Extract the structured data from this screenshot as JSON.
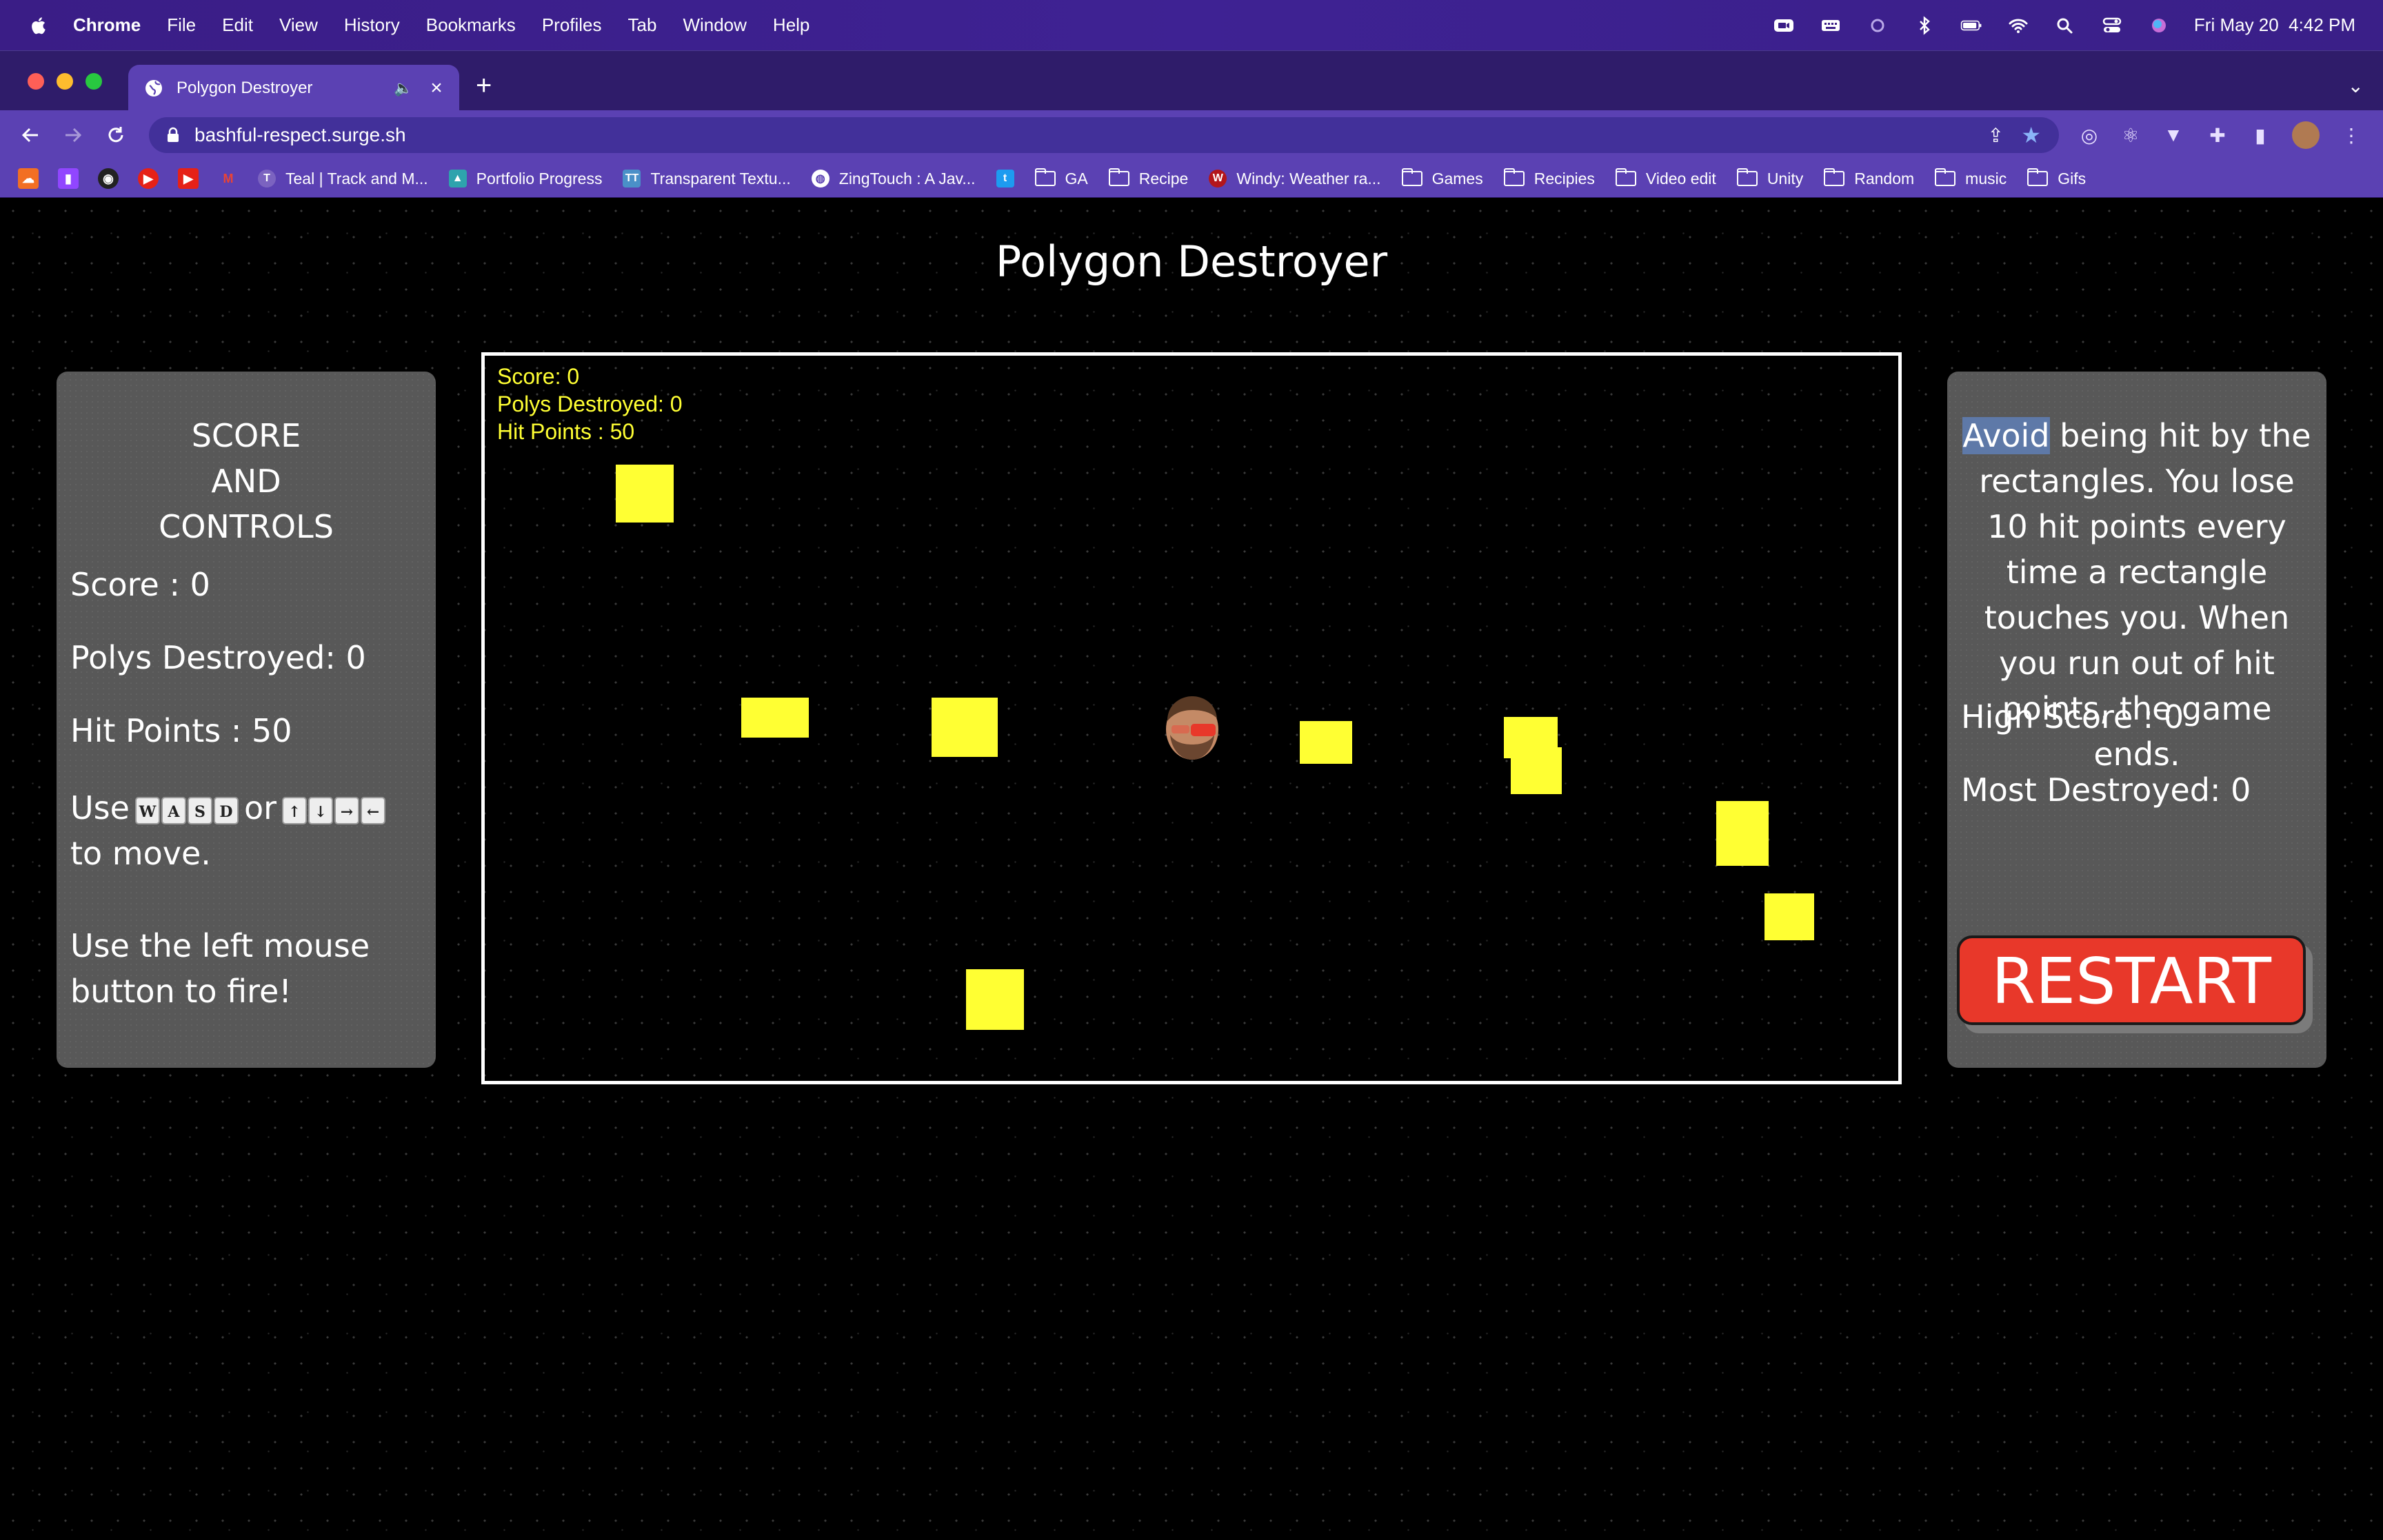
{
  "menubar": {
    "app": "Chrome",
    "items": [
      "File",
      "Edit",
      "View",
      "History",
      "Bookmarks",
      "Profiles",
      "Tab",
      "Window",
      "Help"
    ],
    "clock": "Fri May 20  4:42 PM"
  },
  "browser": {
    "tab_title": "Polygon Destroyer",
    "url": "bashful-respect.surge.sh",
    "bookmarks": [
      "Teal | Track and M...",
      "Portfolio Progress",
      "Transparent Textu...",
      "ZingTouch : A Jav...",
      "GA",
      "Recipe",
      "Windy: Weather ra...",
      "Games",
      "Recipies",
      "Video edit",
      "Unity",
      "Random",
      "music",
      "Gifs"
    ]
  },
  "page": {
    "title": "Polygon Destroyer"
  },
  "left_panel": {
    "heading_line1": "SCORE",
    "heading_line2": "AND",
    "heading_line3": "CONTROLS",
    "score": "Score : 0",
    "polys_destroyed": "Polys Destroyed: 0",
    "hit_points": "Hit Points : 50",
    "use_label": "Use",
    "or_label": "or",
    "wasd_keys": [
      "W",
      "A",
      "S",
      "D"
    ],
    "arrow_keys": [
      "↑",
      "↓",
      "→",
      "←"
    ],
    "to_move": "to move.",
    "fire_line1": "Use the left mouse",
    "fire_line2": "button to fire!"
  },
  "right_panel": {
    "instructions_highlight": "Avoid",
    "instructions_rest": " being hit by the rectangles. You lose 10 hit points every time a rectangle touches you. When you run out of hit points, the game ends.",
    "high_score": "High Score : 0",
    "most_destroyed": "Most Destroyed: 0",
    "restart_label": "RESTART"
  },
  "game": {
    "hud_score": "Score: 0",
    "hud_polys": "Polys Destroyed: 0",
    "hud_hp": "Hit Points : 50",
    "enemy_color": "#ffff33",
    "player_icon": "player-face-icon"
  }
}
